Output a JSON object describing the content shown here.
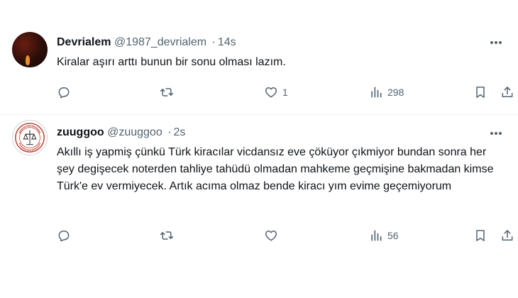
{
  "tweets": [
    {
      "name": "Devrialem",
      "handle": "@1987_devrialem",
      "separator": "·",
      "time": "14s",
      "text": "Kiralar aşırı arttı bunun bir sonu olması lazım.",
      "reply_count": "",
      "retweet_count": "",
      "like_count": "1",
      "view_count": "298"
    },
    {
      "name": "zuuggoo",
      "handle": "@zuuggoo",
      "separator": "·",
      "time": "2s",
      "text": "Akıllı iş yapmiş çünkü Türk kiracılar vicdansız eve çöküyor çıkmiyor bundan sonra her şey degişecek noterden tahliye tahüdü olmadan mahkeme geçmişine bakmadan kimse Türk'e ev vermiyecek. Artık acıma olmaz bende kiracı yım evime geçemiyorum",
      "reply_count": "",
      "retweet_count": "",
      "like_count": "",
      "view_count": "56"
    }
  ],
  "icons": {
    "reply": "reply-icon",
    "retweet": "retweet-icon",
    "like": "heart-icon",
    "views": "views-icon",
    "bookmark": "bookmark-icon",
    "share": "share-icon",
    "more": "more-icon"
  },
  "colors": {
    "text_primary": "#0f1419",
    "text_secondary": "#536471",
    "divider": "#eff3f4"
  }
}
